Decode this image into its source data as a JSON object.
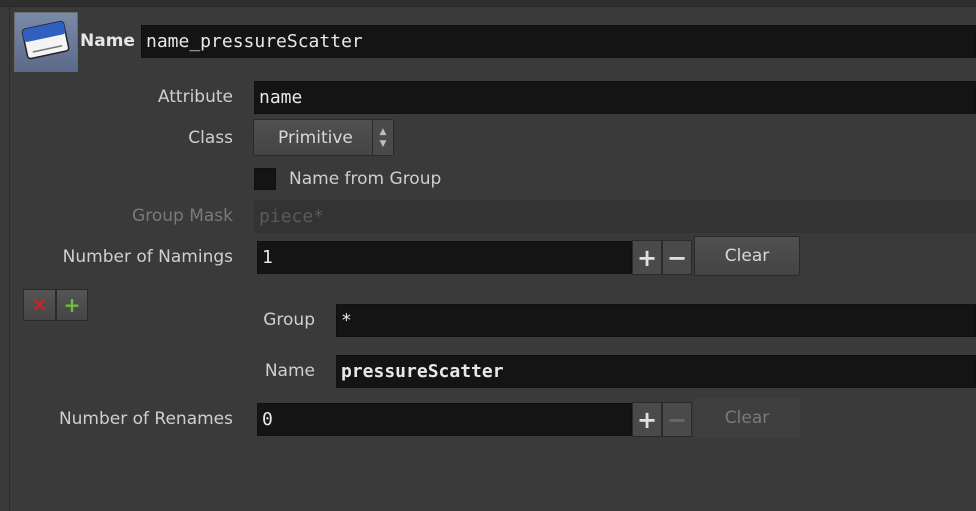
{
  "header": {
    "icon": "name-tag-icon",
    "icon_text": "Hi, my name is",
    "label": "Name",
    "node_name": "name_pressureScatter"
  },
  "params": {
    "attribute": {
      "label": "Attribute",
      "value": "name"
    },
    "class": {
      "label": "Class",
      "value": "Primitive"
    },
    "name_from_group": {
      "label": "Name from Group",
      "checked": false
    },
    "group_mask": {
      "label": "Group Mask",
      "value": "piece*"
    },
    "naming_count": {
      "label": "Number of Namings",
      "value": "1",
      "plus": "+",
      "minus": "−",
      "clear": "Clear"
    },
    "naming_entry": {
      "group_label": "Group",
      "group_value": "*",
      "name_label": "Name",
      "name_value": "pressureScatter",
      "remove_icon": "remove-icon",
      "insert_icon": "insert-icon"
    },
    "rename_count": {
      "label": "Number of Renames",
      "value": "0",
      "plus": "+",
      "minus": "−",
      "clear": "Clear"
    }
  },
  "colors": {
    "background": "#3a3a3a",
    "field": "#141414",
    "button": "#4a4a4a",
    "remove": "#cc2222",
    "insert": "#6fbf3f"
  }
}
